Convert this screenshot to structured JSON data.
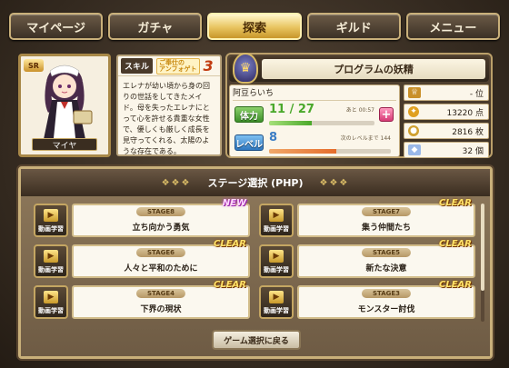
{
  "tabs": [
    {
      "label": "マイページ"
    },
    {
      "label": "ガチャ"
    },
    {
      "label": "探索"
    },
    {
      "label": "ギルド"
    },
    {
      "label": "メニュー"
    }
  ],
  "character": {
    "rarity": "SR",
    "name": "マイヤ"
  },
  "skill": {
    "label": "スキル",
    "name": "ご奉仕の\nアンフォゲト",
    "level": "3",
    "description": "エレナが幼い頃から身の回りの世話をしてきたメイド。母を失ったエレナにとって心を許せる貴重な女性で、優しくも厳しく成長を見守ってくれる、太陽のような存在である。"
  },
  "status": {
    "title": "プログラムの妖精",
    "username": "阿豆らいち",
    "stamina": {
      "label": "体力",
      "value": "11 / 27",
      "current": 11,
      "max": 27,
      "recover": "あと 00:57"
    },
    "level": {
      "label": "レベル",
      "value": "8",
      "next": "次のレベルまで 144",
      "progress": 0.55
    },
    "rank": "- 位",
    "points": "13220 点",
    "coins": "2816 枚",
    "gems": "32 個"
  },
  "stage_panel": {
    "title": "ステージ選択 (PHP)",
    "video_label": "動画学習",
    "stages": [
      {
        "id": "STAGE8",
        "name": "立ち向かう勇気",
        "badge": "NEW",
        "badge_type": "new"
      },
      {
        "id": "STAGE7",
        "name": "集う仲間たち",
        "badge": "CLEAR",
        "badge_type": "clear"
      },
      {
        "id": "STAGE6",
        "name": "人々と平和のために",
        "badge": "CLEAR",
        "badge_type": "clear"
      },
      {
        "id": "STAGE5",
        "name": "新たな決意",
        "badge": "CLEAR",
        "badge_type": "clear"
      },
      {
        "id": "STAGE4",
        "name": "下界の現状",
        "badge": "CLEAR",
        "badge_type": "clear"
      },
      {
        "id": "STAGE3",
        "name": "モンスター討伐",
        "badge": "CLEAR",
        "badge_type": "clear"
      }
    ],
    "back_label": "ゲーム選択に戻る"
  },
  "colors": {
    "accent_gold": "#c9b07a",
    "clear": "#ffe36a",
    "stamina": "#4aa82a",
    "level": "#3a7cc4"
  }
}
